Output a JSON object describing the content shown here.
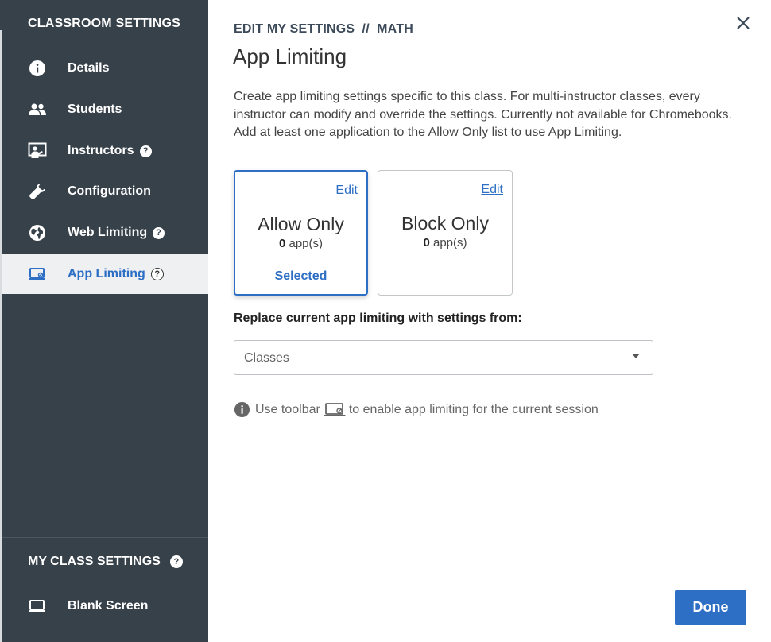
{
  "sidebar": {
    "title": "CLASSROOM SETTINGS",
    "items": [
      {
        "label": "Details",
        "icon": "info-icon"
      },
      {
        "label": "Students",
        "icon": "people-icon"
      },
      {
        "label": "Instructors",
        "icon": "presenter-icon",
        "help": "?"
      },
      {
        "label": "Configuration",
        "icon": "wrench-icon"
      },
      {
        "label": "Web Limiting",
        "icon": "globe-icon",
        "help": "?"
      },
      {
        "label": "App Limiting",
        "icon": "laptop-limit-icon",
        "help": "?",
        "active": true
      }
    ],
    "my_class_title": "MY CLASS SETTINGS",
    "my_class_help": "?",
    "blank_screen_label": "Blank Screen"
  },
  "main": {
    "breadcrumb": "EDIT MY SETTINGS  //  MATH",
    "title": "App Limiting",
    "description": "Create app limiting settings specific to this class. For multi-instructor classes, every instructor can modify and override the settings. Currently not available for Chromebooks. Add at least one application to the Allow Only list to use App Limiting.",
    "cards": [
      {
        "name": "Allow Only",
        "count": "0",
        "count_suffix": " app(s)",
        "edit": "Edit",
        "selected_label": "Selected"
      },
      {
        "name": "Block Only",
        "count": "0",
        "count_suffix": " app(s)",
        "edit": "Edit"
      }
    ],
    "replace_label": "Replace current app limiting with settings from:",
    "replace_select_value": "Classes",
    "hint_before": "Use toolbar",
    "hint_after": "to enable app limiting for the current session",
    "done_label": "Done"
  },
  "colors": {
    "sidebar_bg": "#37414a",
    "accent": "#2d6fc4",
    "active_item_bg": "#eef0f2"
  }
}
